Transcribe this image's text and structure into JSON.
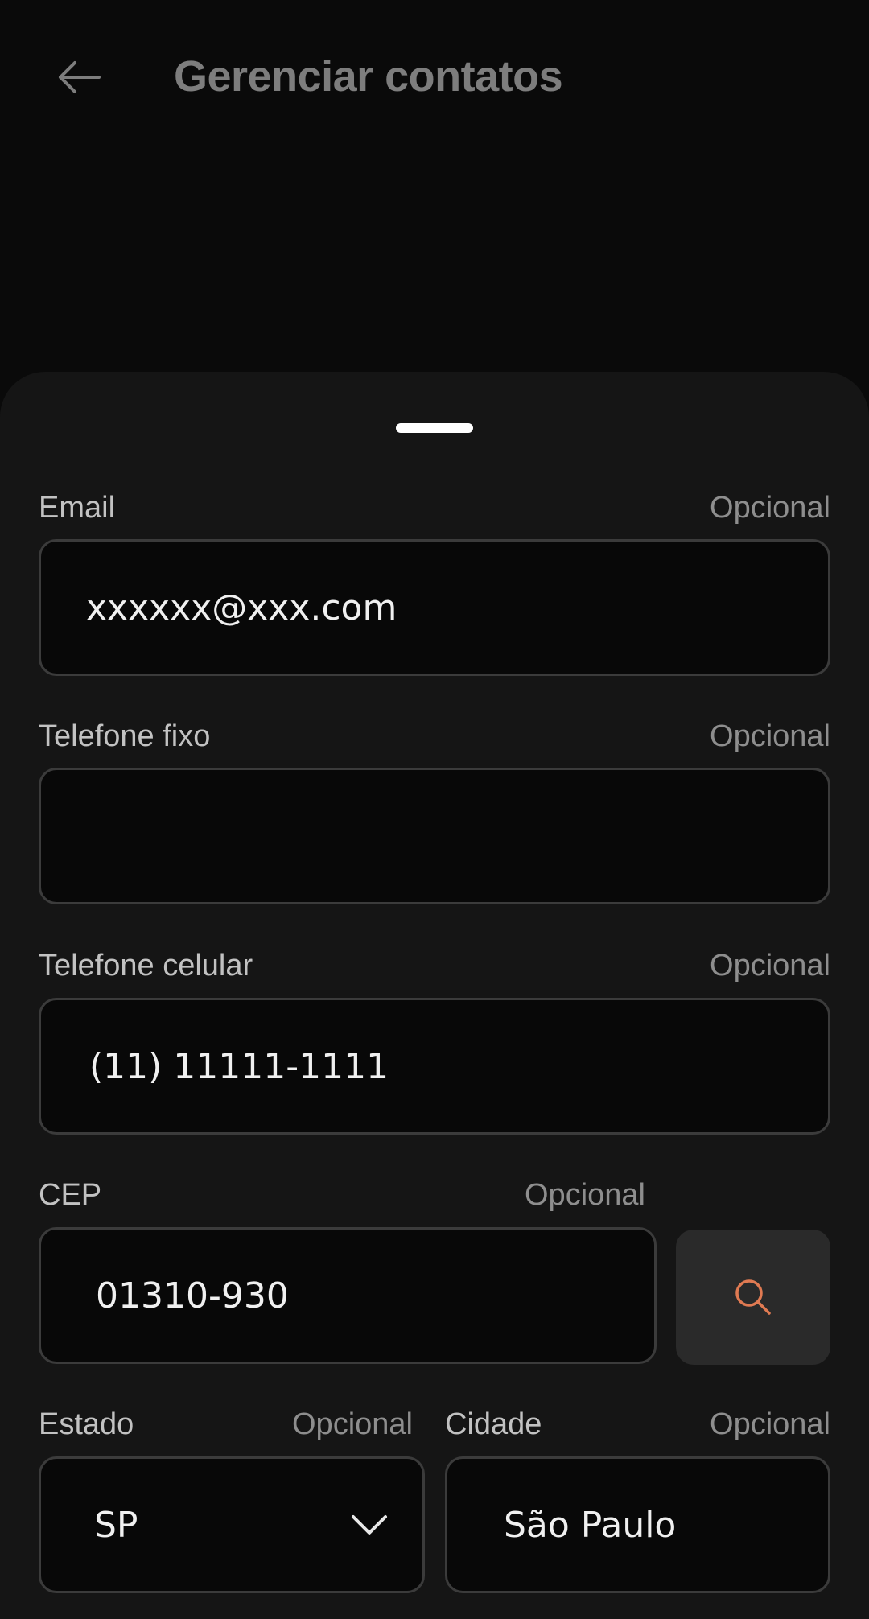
{
  "header": {
    "title": "Gerenciar contatos",
    "back_icon": "arrow-left-icon"
  },
  "form": {
    "optional_label": "Opcional",
    "email": {
      "label": "Email",
      "value": "xxxxxx@xxx.com"
    },
    "landline": {
      "label": "Telefone fixo",
      "value": ""
    },
    "mobile": {
      "label": "Telefone celular",
      "value": "(11) 11111-1111"
    },
    "cep": {
      "label": "CEP",
      "value": "01310-930",
      "search_icon": "search-icon"
    },
    "state": {
      "label": "Estado",
      "value": "SP",
      "dropdown_icon": "chevron-down-icon"
    },
    "city": {
      "label": "Cidade",
      "value": "São Paulo"
    }
  },
  "colors": {
    "background": "#0a0a0a",
    "sheet": "#151515",
    "accent": "#e07a52"
  }
}
